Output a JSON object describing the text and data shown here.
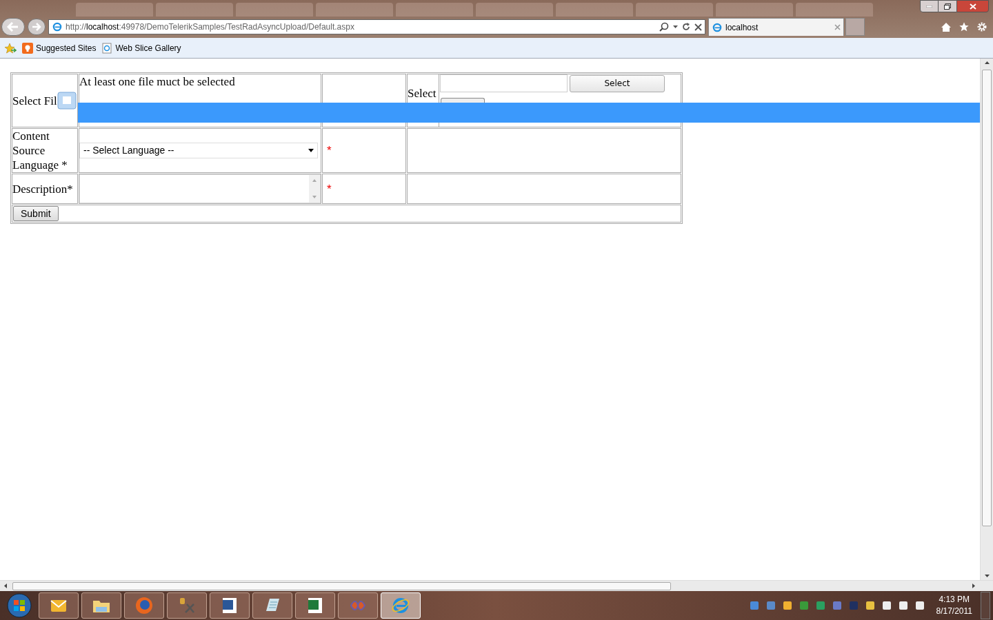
{
  "browser": {
    "url_prefix": "http://",
    "url_host": "localhost",
    "url_path": ":49978/DemoTelerikSamples/TestRadAsyncUpload/Default.aspx",
    "tab_title": "localhost"
  },
  "favorites": [
    {
      "label": "Suggested Sites",
      "kind": "suggested"
    },
    {
      "label": "Web Slice Gallery",
      "kind": "webslice"
    }
  ],
  "form": {
    "select_files_label": "Select Fil",
    "validation_message": "At least one file muct be selected",
    "upload_label": "Select",
    "select_button": "Select",
    "language_label": "Content Source Language *",
    "language_value": "-- Select Language --",
    "language_required": "*",
    "description_label": "Description*",
    "description_required": "*",
    "submit_button": "Submit"
  },
  "taskbar": {
    "time": "4:13 PM",
    "date": "8/17/2011",
    "apps": [
      {
        "kind": "mail",
        "selected": false
      },
      {
        "kind": "folder",
        "selected": false
      },
      {
        "kind": "globe",
        "selected": false
      },
      {
        "kind": "tools",
        "selected": false
      },
      {
        "kind": "document",
        "selected": false
      },
      {
        "kind": "notepad",
        "selected": false
      },
      {
        "kind": "sheet",
        "selected": false
      },
      {
        "kind": "studio",
        "selected": false
      },
      {
        "kind": "ie",
        "selected": true
      }
    ]
  }
}
